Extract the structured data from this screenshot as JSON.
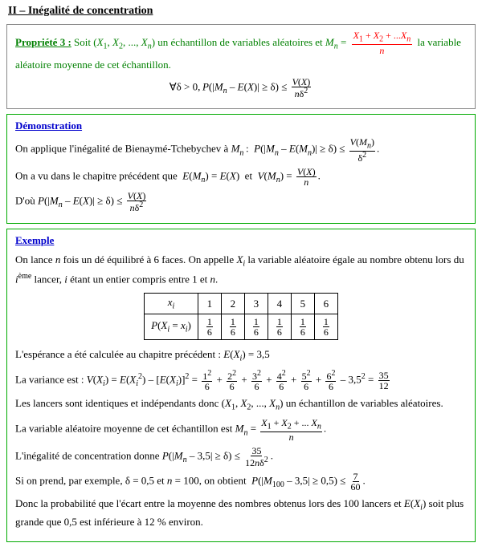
{
  "main_title": "II – Inégalité de concentration",
  "property": {
    "label": "Propriété 3 :",
    "text1": " Soit (",
    "x_vars": "X₁, X₂, …, Xₙ",
    "text2": ") un échantillon de variables aléatoires et ",
    "Mn": "Mₙ",
    "text3": " = ",
    "frac_num": "X₁ + X₂ + ... Xₙ",
    "frac_den": "n",
    "text4": " la variable aléatoire moyenne de cet échantillon.",
    "formula": "∀δ > 0, P(|Mₙ – E(X)| ≥ δ) ≤",
    "formula_frac_num": "V(X)",
    "formula_frac_den": "nδ²"
  },
  "demonstration": {
    "title": "Démonstration",
    "para1": "On applique l'inégalité de Bienaymé-Tchebychev à Mₙ : P(|Mₙ – E(Mₙ)| ≥ δ) ≤",
    "para1_frac_num": "V(Mₙ)",
    "para1_frac_den": "δ²",
    "para2_pre": "On a vu dans le chapitre précédent que ",
    "para2_eq1": "E(Mₙ) = E(X)",
    "para2_and": " et ",
    "para2_eq2": "V(Mₙ) =",
    "para2_frac_num": "V(X)",
    "para2_frac_den": "n",
    "para3_pre": "D'où P(|Mₙ – E(X)| ≥ δ) ≤",
    "para3_frac_num": "V(X)",
    "para3_frac_den": "nδ²"
  },
  "example": {
    "title": "Exemple",
    "intro": "On lance n fois un dé équilibré à 6 faces. On appelle Xᵢ la variable aléatoire égale au nombre obtenu lors du iᵉᵐᵉ lancer, i étant un entier compris entre 1 et n.",
    "table_headers": [
      "xᵢ",
      "1",
      "2",
      "3",
      "4",
      "5",
      "6"
    ],
    "table_row_label": "P(Xᵢ = xᵢ)",
    "table_row_values": [
      "1/6",
      "1/6",
      "1/6",
      "1/6",
      "1/6",
      "1/6"
    ],
    "esperance_line": "L'espérance a été calculée au chapitre précédent : E(Xᵢ) = 3,5",
    "variance_label": "La variance est : V(Xᵢ) = E(Xᵢ²) – [E(Xᵢ)]² =",
    "variance_calc": "1²/6 + 2²/6 + 3²/6 + 4²/6 + 5²/6 + 6²/6 – 3,5² = 35/12",
    "lancers_line": "Les lancers sont identiques et indépendants donc (X₁, X₂, …, Xₙ) un échantillon de variables aléatoires.",
    "moyenne_line": "La variable aléatoire moyenne de cet échantillon est Mₙ =",
    "moyenne_frac_num": "X₁ + X₂ + … Xₙ",
    "moyenne_frac_den": "n",
    "inegalite_line": "L'inégalité de concentration donne P(|Mₙ – 3,5| ≥ δ) ≤",
    "inegalite_frac_num": "35",
    "inegalite_frac_den": "12nδ²",
    "si_line": "Si on prend, par exemple, δ = 0,5 et n = 100, on obtient P(|M₁₀₀ – 3,5| ≥ 0,5) ≤",
    "si_frac_num": "7",
    "si_frac_den": "60",
    "donc_line": "Donc la probabilité que l'écart entre la moyenne des nombres obtenus lors des 100 lancers et E(Xᵢ) soit plus grande que 0,5 est inférieure à 12 % environ."
  }
}
